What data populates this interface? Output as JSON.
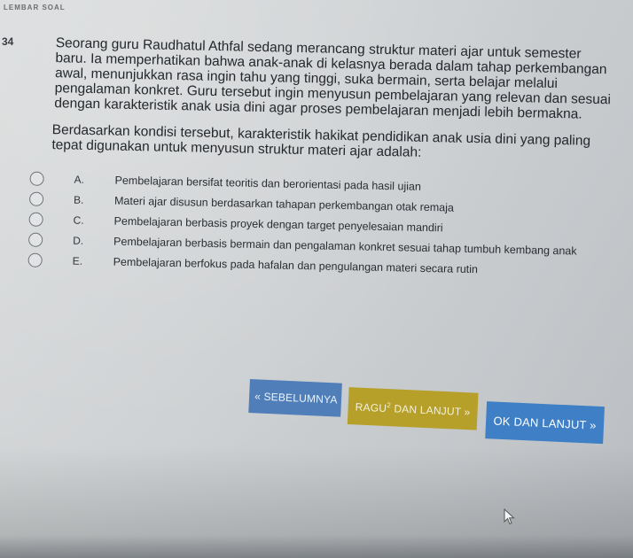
{
  "page": {
    "heading": "Lembar Soal"
  },
  "question": {
    "number": "34",
    "text": "Seorang guru Raudhatul Athfal sedang merancang struktur materi ajar untuk semester baru. Ia memperhatikan bahwa anak-anak di kelasnya berada dalam tahap perkembangan awal, menunjukkan rasa ingin tahu yang tinggi, suka bermain, serta belajar melalui pengalaman konkret. Guru tersebut ingin menyusun pembelajaran yang relevan dan sesuai dengan karakteristik anak usia dini agar proses pembelajaran menjadi lebih bermakna.",
    "prompt": "Berdasarkan kondisi tersebut, karakteristik hakikat pendidikan anak usia dini yang paling tepat digunakan untuk menyusun struktur materi ajar adalah:"
  },
  "options": [
    {
      "letter": "A.",
      "text": "Pembelajaran bersifat teoritis dan berorientasi pada hasil ujian"
    },
    {
      "letter": "B.",
      "text": "Materi ajar disusun berdasarkan tahapan perkembangan otak remaja"
    },
    {
      "letter": "C.",
      "text": "Pembelajaran berbasis proyek dengan target penyelesaian mandiri"
    },
    {
      "letter": "D.",
      "text": "Pembelajaran berbasis bermain dan pengalaman konkret sesuai tahap tumbuh kembang anak"
    },
    {
      "letter": "E.",
      "text": "Pembelajaran berfokus pada hafalan dan pengulangan materi secara rutin"
    }
  ],
  "navigation": {
    "prev_label": "« SEBELUMNYA",
    "doubt_label": "RAGU",
    "doubt_sup": "2",
    "doubt_suffix": " DAN LANJUT »",
    "next_label": "OK DAN LANJUT »"
  },
  "colors": {
    "prev_button": "#4f7eb8",
    "doubt_button": "#b6a02a",
    "next_button": "#3f7fc6"
  },
  "icons": {
    "cursor": "mouse-pointer-icon"
  }
}
